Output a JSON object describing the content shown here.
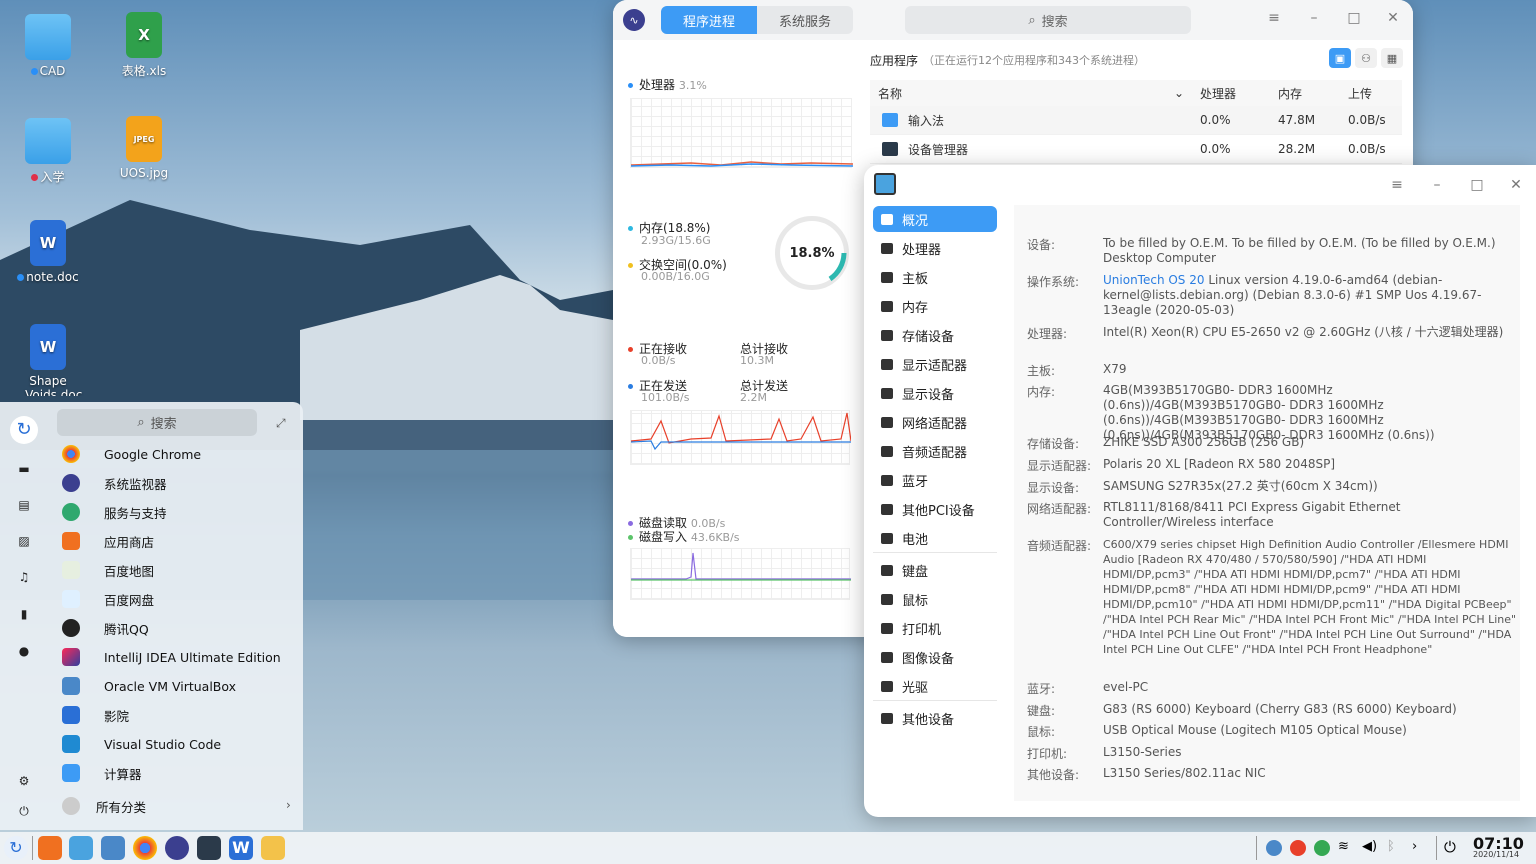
{
  "desktop": {
    "icons": [
      {
        "label": "CAD"
      },
      {
        "label": "表格.xls"
      },
      {
        "label": "入学"
      },
      {
        "label": "UOS.jpg"
      },
      {
        "label": "note.doc"
      },
      {
        "label": "Shape"
      },
      {
        "label": "...Voids.doc"
      }
    ],
    "jpeg_badge": "JPEG"
  },
  "system_monitor": {
    "tabs": [
      "程序进程",
      "系统服务"
    ],
    "search_placeholder": "搜索",
    "cpu": {
      "label": "处理器",
      "value": "3.1%"
    },
    "memory": {
      "label": "内存(18.8%)",
      "value": "2.93G/15.6G"
    },
    "swap": {
      "label": "交换空间(0.0%)",
      "value": "0.00B/16.0G"
    },
    "gauge_value": "18.8%",
    "receiving": {
      "label": "正在接收",
      "value": "0.0B/s"
    },
    "total_received": {
      "label": "总计接收",
      "value": "10.3M"
    },
    "sending": {
      "label": "正在发送",
      "value": "101.0B/s"
    },
    "total_sent": {
      "label": "总计发送",
      "value": "2.2M"
    },
    "disk_read": {
      "label": "磁盘读取",
      "value": "0.0B/s"
    },
    "disk_write": {
      "label": "磁盘写入",
      "value": "43.6KB/s"
    },
    "apps_title": "应用程序",
    "apps_note": "（正在运行12个应用程序和343个系统进程）",
    "columns": [
      "名称",
      "处理器",
      "内存",
      "上传"
    ],
    "rows": [
      {
        "name": "输入法",
        "cpu": "0.0%",
        "mem": "47.8M",
        "up": "0.0B/s"
      },
      {
        "name": "设备管理器",
        "cpu": "0.0%",
        "mem": "28.2M",
        "up": "0.0B/s"
      }
    ],
    "colors": {
      "accent": "#3d9bf5",
      "cpu_dot": "#2a8ff7",
      "mem_dot": "#2db8e0",
      "swap_dot": "#f0c020",
      "recv": "#e8402a",
      "send": "#2a7de1",
      "read": "#8a6be0",
      "write": "#5cc46a"
    }
  },
  "device_manager": {
    "nav": [
      "概况",
      "处理器",
      "主板",
      "内存",
      "存储设备",
      "显示适配器",
      "显示设备",
      "网络适配器",
      "音频适配器",
      "蓝牙",
      "其他PCI设备",
      "电池",
      "键盘",
      "鼠标",
      "打印机",
      "图像设备",
      "光驱",
      "其他设备"
    ],
    "details": [
      {
        "k": "设备:",
        "v": "To be filled by O.E.M. To be filled by O.E.M. (To be filled by O.E.M.) Desktop Computer"
      },
      {
        "k": "操作系统:",
        "v_hl": "UnionTech OS 20",
        "v": " Linux version 4.19.0-6-amd64 (debian-kernel@lists.debian.org) (Debian 8.3.0-6) #1 SMP Uos 4.19.67-13eagle (2020-05-03)"
      },
      {
        "k": "处理器:",
        "v": "Intel(R) Xeon(R) CPU E5-2650 v2 @ 2.60GHz (八核 / 十六逻辑处理器)"
      },
      {
        "k": "主板:",
        "v": "X79"
      },
      {
        "k": "内存:",
        "v": "4GB(M393B5170GB0- DDR3 1600MHz (0.6ns))/4GB(M393B5170GB0- DDR3 1600MHz (0.6ns))/4GB(M393B5170GB0- DDR3 1600MHz (0.6ns))/4GB(M393B5170GB0- DDR3 1600MHz (0.6ns))"
      },
      {
        "k": "存储设备:",
        "v": "ZHIKE SSD A300 256GB (256 GB)"
      },
      {
        "k": "显示适配器:",
        "v": "Polaris 20 XL [Radeon RX 580 2048SP]"
      },
      {
        "k": "显示设备:",
        "v": "SAMSUNG S27R35x(27.2 英寸(60cm X 34cm))"
      },
      {
        "k": "网络适配器:",
        "v": "RTL8111/8168/8411 PCI Express Gigabit Ethernet Controller/Wireless interface"
      },
      {
        "k": "音频适配器:",
        "v": "C600/X79 series chipset High Definition Audio Controller /Ellesmere HDMI Audio [Radeon RX 470/480 / 570/580/590] /\"HDA ATI HDMI HDMI/DP,pcm3\" /\"HDA ATI HDMI HDMI/DP,pcm7\" /\"HDA ATI HDMI HDMI/DP,pcm8\" /\"HDA ATI HDMI HDMI/DP,pcm9\" /\"HDA ATI HDMI HDMI/DP,pcm10\" /\"HDA ATI HDMI HDMI/DP,pcm11\" /\"HDA Digital PCBeep\" /\"HDA Intel PCH Rear Mic\" /\"HDA Intel PCH Front Mic\" /\"HDA Intel PCH Line\" /\"HDA Intel PCH Line Out Front\" /\"HDA Intel PCH Line Out Surround\" /\"HDA Intel PCH Line Out CLFE\" /\"HDA Intel PCH Front Headphone\""
      },
      {
        "k": "蓝牙:",
        "v": "evel-PC"
      },
      {
        "k": "键盘:",
        "v": "G83 (RS 6000) Keyboard (Cherry G83 (RS 6000) Keyboard)"
      },
      {
        "k": "鼠标:",
        "v": "USB Optical Mouse (Logitech M105 Optical Mouse)"
      },
      {
        "k": "打印机:",
        "v": "L3150-Series"
      },
      {
        "k": "其他设备:",
        "v": "L3150 Series/802.11ac NIC"
      }
    ]
  },
  "launcher": {
    "search_placeholder": "搜索",
    "apps": [
      "Google Chrome",
      "系统监视器",
      "服务与支持",
      "应用商店",
      "百度地图",
      "百度网盘",
      "腾讯QQ",
      "IntelliJ IDEA Ultimate Edition",
      "Oracle VM VirtualBox",
      "影院",
      "Visual Studio Code",
      "计算器"
    ],
    "all_categories": "所有分类"
  },
  "taskbar": {
    "time": "07:10",
    "date": "2020/11/14"
  }
}
